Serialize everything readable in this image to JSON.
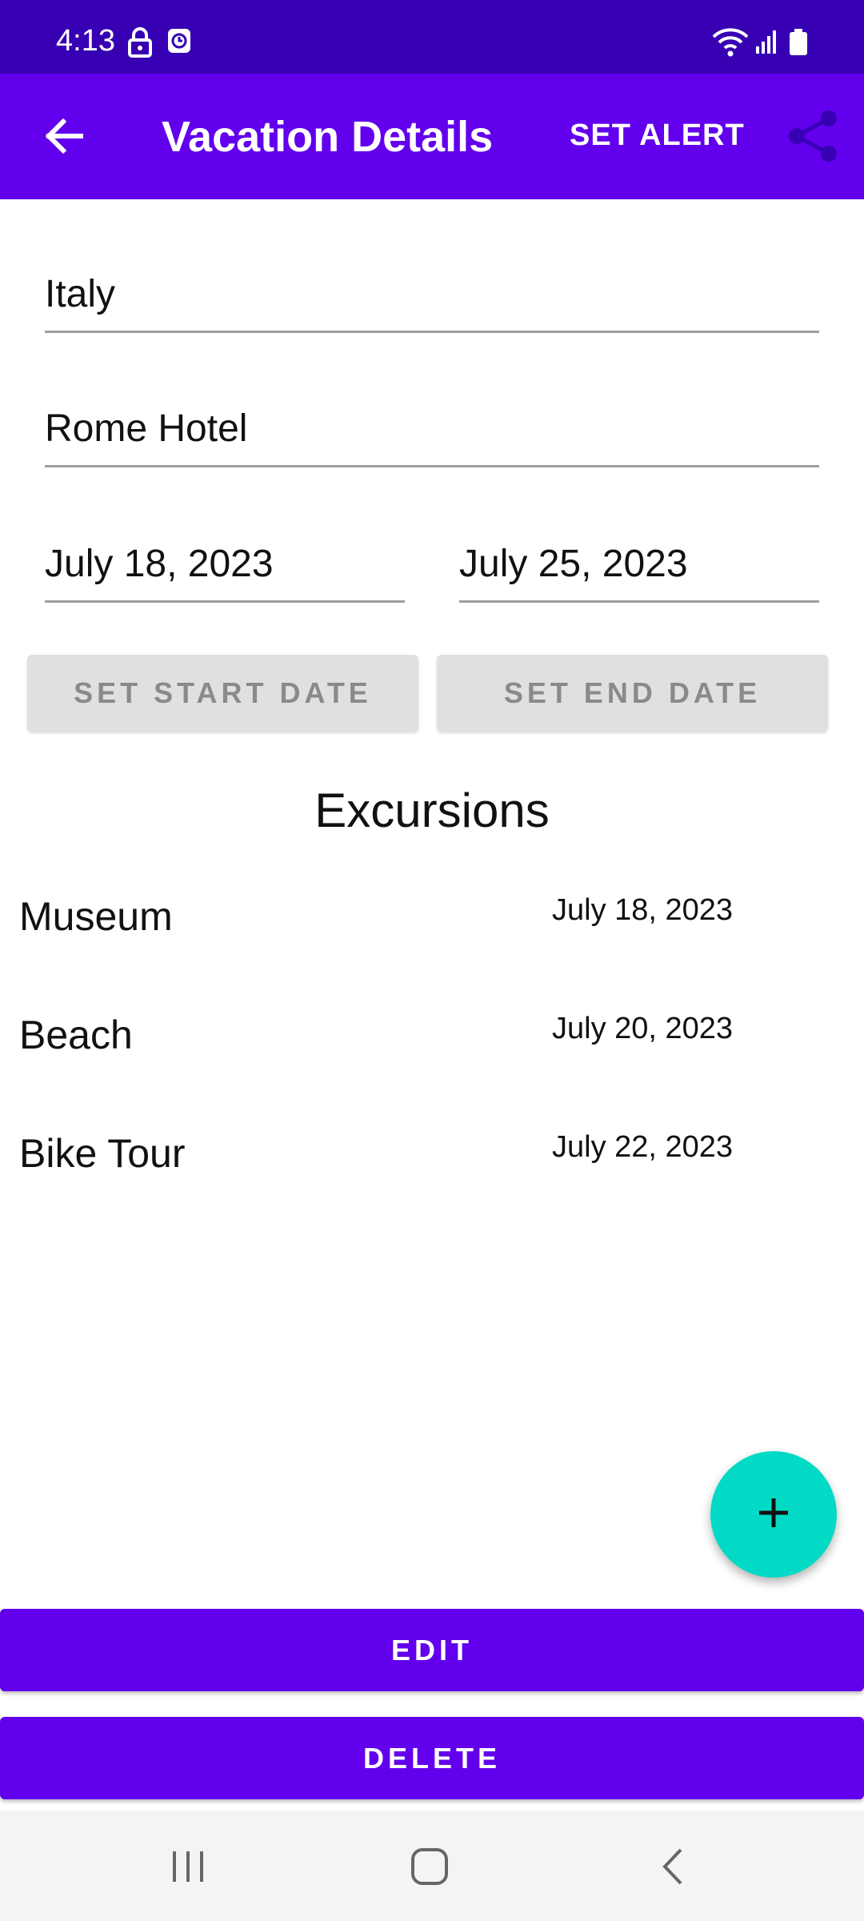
{
  "status_bar": {
    "time": "4:13",
    "icons": [
      "lock-icon",
      "alarm-clock-icon",
      "wifi-icon",
      "signal-icon",
      "battery-icon"
    ]
  },
  "app_bar": {
    "back_icon": "arrow-back-icon",
    "title": "Vacation Details",
    "set_alert_label": "SET ALERT",
    "share_icon": "share-icon",
    "color": "#6200ee"
  },
  "form": {
    "title_value": "Italy",
    "hotel_value": "Rome Hotel",
    "start_date_value": "July 18, 2023",
    "end_date_value": "July 25, 2023",
    "set_start_date_label": "SET START DATE",
    "set_end_date_label": "SET END DATE"
  },
  "excursions": {
    "heading": "Excursions",
    "items": [
      {
        "name": "Museum",
        "date": "July 18, 2023"
      },
      {
        "name": "Beach",
        "date": "July 20, 2023"
      },
      {
        "name": "Bike Tour",
        "date": "July 22, 2023"
      }
    ]
  },
  "fab": {
    "icon": "plus-icon",
    "color": "#03dac5"
  },
  "actions": {
    "edit_label": "EDIT",
    "delete_label": "DELETE"
  },
  "nav_bar": {
    "icons": [
      "recent-apps-icon",
      "home-icon",
      "back-nav-icon"
    ]
  }
}
